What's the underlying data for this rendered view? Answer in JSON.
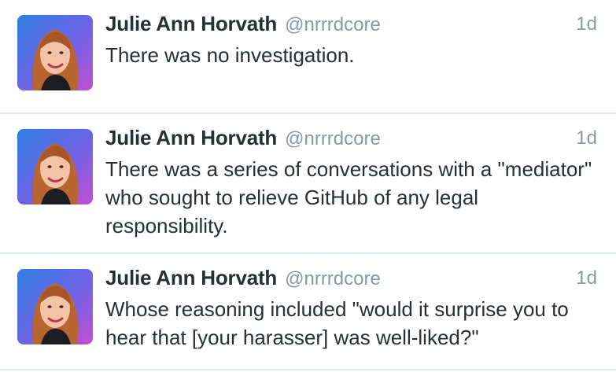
{
  "tweets": [
    {
      "fullname": "Julie Ann Horvath",
      "username": "@nrrrdcore",
      "time": "1d",
      "text": "There was no investigation."
    },
    {
      "fullname": "Julie Ann Horvath",
      "username": "@nrrrdcore",
      "time": "1d",
      "text": "There was a series of conversations with a \"mediator\" who sought to relieve GitHub of any legal responsibility."
    },
    {
      "fullname": "Julie Ann Horvath",
      "username": "@nrrrdcore",
      "time": "1d",
      "text": "Whose reasoning included \"would it surprise you to hear that [your harasser] was well-liked?\""
    }
  ],
  "colors": {
    "name": "#292f33",
    "meta": "#8899a6",
    "divider": "#e1e8ed",
    "avatar_bg_top": "#3a7bd5",
    "avatar_bg_bottom": "#b14fd8"
  },
  "icons": {
    "avatar": "profile-photo-avatar"
  }
}
